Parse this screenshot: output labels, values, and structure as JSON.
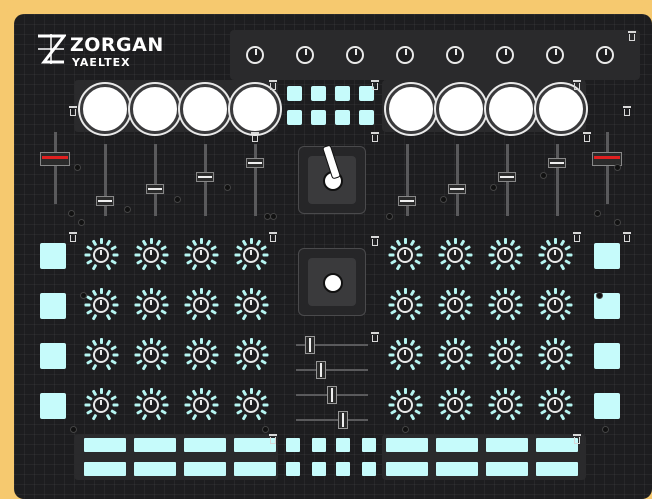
{
  "brand": {
    "name": "ZORGAN",
    "sub": "YAELTEX"
  },
  "colors": {
    "frame": "#f6c96f",
    "panel": "#1d1d1f",
    "pad": "#c6fbfb",
    "ring": "#b6f6f2",
    "fader_red": "#e02020"
  },
  "icons": {
    "delete": "trash-icon",
    "logo": "zorgan-logo-icon"
  },
  "controls": {
    "top_knobs": 8,
    "big_buttons": 8,
    "center_pads": 8,
    "faders": 10,
    "joysticks": 2,
    "side_pads": 8,
    "encoders": 32,
    "bottom_wide_buttons": 16,
    "bottom_square_buttons": 8,
    "horizontal_faders": 4
  }
}
